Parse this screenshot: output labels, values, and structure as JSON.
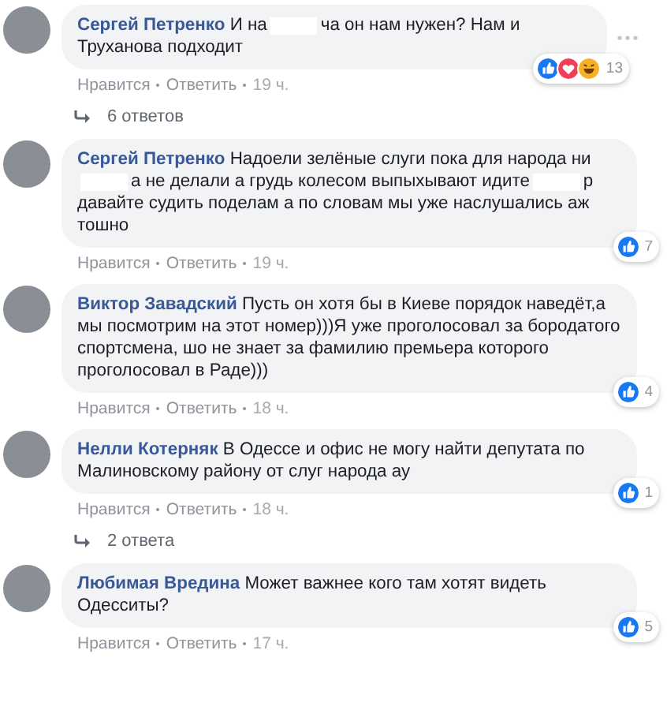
{
  "comments": [
    {
      "author": "Сергей Петренко",
      "body": [
        {
          "kind": "text",
          "text": "И на"
        },
        {
          "kind": "redaction"
        },
        {
          "kind": "text",
          "text": "ча он нам нужен? Нам и Труханова подходит"
        }
      ],
      "menu": true,
      "reactions": [
        {
          "kind": "like"
        },
        {
          "kind": "love"
        },
        {
          "kind": "haha"
        }
      ],
      "reaction_count": "13",
      "actions": [
        {
          "kind": "link",
          "text": "Нравится"
        },
        {
          "kind": "link",
          "text": "Ответить"
        },
        {
          "kind": "time",
          "text": "19 ч."
        }
      ],
      "replies": "6 ответов"
    },
    {
      "author": "Сергей Петренко",
      "body": [
        {
          "kind": "text",
          "text": "Надоели зелёные слуги пока для народа ни"
        },
        {
          "kind": "redaction"
        },
        {
          "kind": "text",
          "text": "а не делали а грудь колесом выпыхывают идите"
        },
        {
          "kind": "redaction"
        },
        {
          "kind": "text",
          "text": "р давайте судить поделам а по словам мы уже наслушались аж тошно"
        }
      ],
      "menu": false,
      "reactions": [
        {
          "kind": "like"
        }
      ],
      "reaction_count": "7",
      "actions": [
        {
          "kind": "link",
          "text": "Нравится"
        },
        {
          "kind": "link",
          "text": "Ответить"
        },
        {
          "kind": "time",
          "text": "19 ч."
        }
      ]
    },
    {
      "author": "Виктор Завадский",
      "body": [
        {
          "kind": "text",
          "text": "Пусть он хотя бы в Киеве порядок наведёт,а мы посмотрим на этот номер)))Я уже проголосовал за бородатого спортсмена, шо не знает за фамилию премьера которого проголосовал в Раде)))"
        }
      ],
      "menu": false,
      "reactions": [
        {
          "kind": "like"
        }
      ],
      "reaction_count": "4",
      "actions": [
        {
          "kind": "link",
          "text": "Нравится"
        },
        {
          "kind": "link",
          "text": "Ответить"
        },
        {
          "kind": "time",
          "text": "18 ч."
        }
      ]
    },
    {
      "author": "Нелли Котерняк",
      "body": [
        {
          "kind": "text",
          "text": "В Одессе и офис не могу найти депутата по Малиновскому району от слуг народа ау"
        }
      ],
      "menu": false,
      "reactions": [
        {
          "kind": "like"
        }
      ],
      "reaction_count": "1",
      "actions": [
        {
          "kind": "link",
          "text": "Нравится"
        },
        {
          "kind": "link",
          "text": "Ответить"
        },
        {
          "kind": "time",
          "text": "18 ч."
        }
      ],
      "replies": "2 ответа"
    },
    {
      "author": "Любимая Вредина",
      "body": [
        {
          "kind": "text",
          "text": "Может важнее кого там хотят видеть Одесситы?"
        }
      ],
      "menu": false,
      "reactions": [
        {
          "kind": "like"
        }
      ],
      "reaction_count": "5",
      "actions": [
        {
          "kind": "link",
          "text": "Нравится"
        },
        {
          "kind": "link",
          "text": "Ответить"
        },
        {
          "kind": "time",
          "text": "17 ч."
        }
      ]
    }
  ]
}
